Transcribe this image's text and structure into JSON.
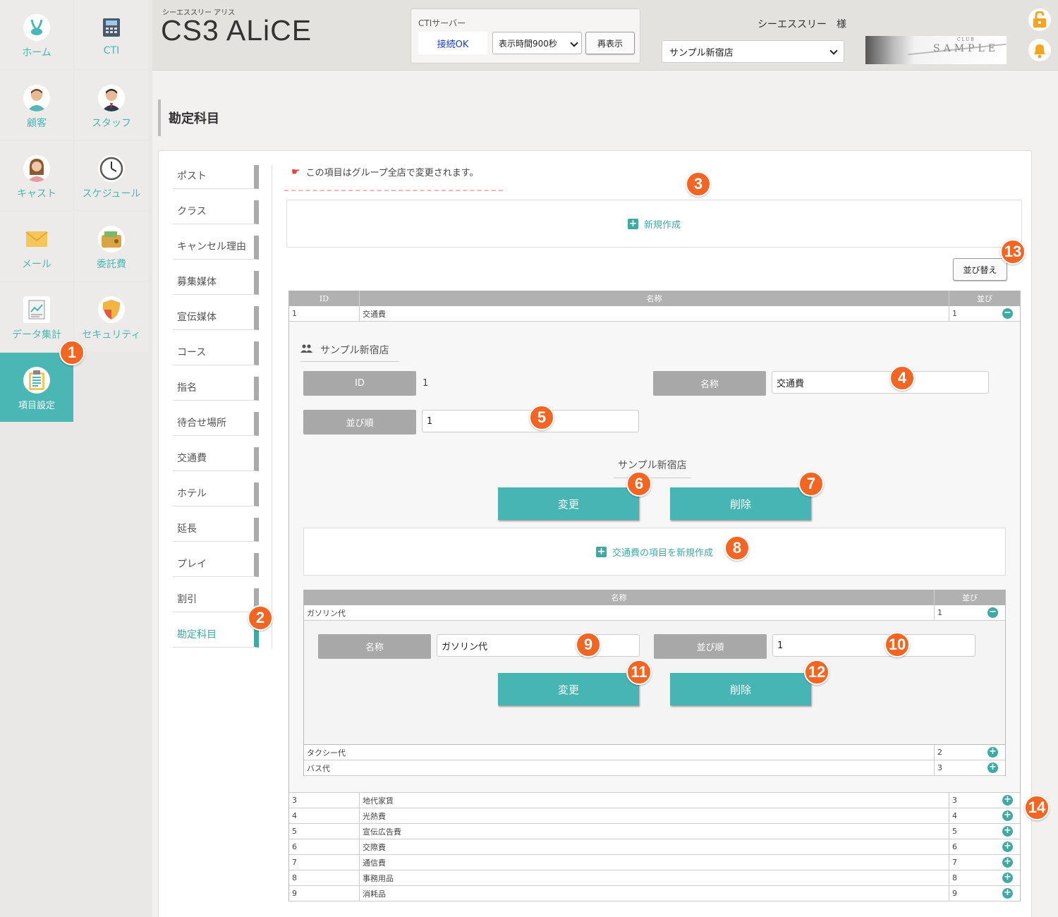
{
  "sidebar": {
    "items": [
      {
        "label": "ホーム",
        "icon": "rabbit-icon"
      },
      {
        "label": "CTI",
        "icon": "phone-icon"
      },
      {
        "label": "顧客",
        "icon": "customer-icon"
      },
      {
        "label": "スタッフ",
        "icon": "staff-icon"
      },
      {
        "label": "キャスト",
        "icon": "cast-icon"
      },
      {
        "label": "スケジュール",
        "icon": "clock-icon"
      },
      {
        "label": "メール",
        "icon": "mail-icon"
      },
      {
        "label": "委託費",
        "icon": "wallet-icon"
      },
      {
        "label": "データ集計",
        "icon": "report-icon"
      },
      {
        "label": "セキュリティ",
        "icon": "shield-icon"
      },
      {
        "label": "項目設定",
        "icon": "clipboard-icon"
      }
    ]
  },
  "header": {
    "sub_brand": "シーエススリー アリス",
    "brand": "CS3 ALiCE",
    "cti_title": "CTIサーバー",
    "cti_status": "接続OK",
    "cti_display": "表示時間900秒",
    "refresh": "再表示",
    "user": "シーエススリー　様",
    "store": "サンプル新宿店",
    "banner_club": "CLUB",
    "banner_sample": "SAMPLE"
  },
  "page": {
    "title": "勘定科目"
  },
  "subnav": [
    "ポスト",
    "クラス",
    "キャンセル理由",
    "募集媒体",
    "宣伝媒体",
    "コース",
    "指名",
    "待合せ場所",
    "交通費",
    "ホテル",
    "延長",
    "プレイ",
    "割引",
    "勘定科目"
  ],
  "notice": "この項目はグループ全店で変更されます。",
  "new_create": "新規作成",
  "sort_button": "並び替え",
  "table": {
    "headers": [
      "ID",
      "名称",
      "並び"
    ],
    "expanded_row": {
      "id": "1",
      "name": "交通費",
      "order": "1"
    },
    "rows": [
      {
        "id": "3",
        "name": "地代家賃",
        "order": "3"
      },
      {
        "id": "4",
        "name": "光熱費",
        "order": "4"
      },
      {
        "id": "5",
        "name": "宣伝広告費",
        "order": "5"
      },
      {
        "id": "6",
        "name": "交際費",
        "order": "6"
      },
      {
        "id": "7",
        "name": "通信費",
        "order": "7"
      },
      {
        "id": "8",
        "name": "事務用品",
        "order": "8"
      },
      {
        "id": "9",
        "name": "消耗品",
        "order": "9"
      }
    ]
  },
  "edit": {
    "store": "サンプル新宿店",
    "id_label": "ID",
    "id_value": "1",
    "name_label": "名称",
    "name_value": "交通費",
    "order_label": "並び順",
    "order_value": "1",
    "store2": "サンプル新宿店",
    "change": "変更",
    "delete": "削除",
    "sub_new": "交通費の項目を新規作成"
  },
  "subtable": {
    "headers": [
      "名称",
      "並び"
    ],
    "expanded_row": {
      "name": "ガソリン代",
      "order": "1"
    },
    "edit": {
      "name_label": "名称",
      "name_value": "ガソリン代",
      "order_label": "並び順",
      "order_value": "1",
      "change": "変更",
      "delete": "削除"
    },
    "rows": [
      {
        "name": "タクシー代",
        "order": "2"
      },
      {
        "name": "バス代",
        "order": "3"
      }
    ]
  },
  "badges": [
    "1",
    "2",
    "3",
    "4",
    "5",
    "6",
    "7",
    "8",
    "9",
    "10",
    "11",
    "12",
    "13",
    "14"
  ],
  "colors": {
    "accent": "#47b5b4",
    "badge": "#f26522",
    "header_bg": "#e3e2df"
  }
}
